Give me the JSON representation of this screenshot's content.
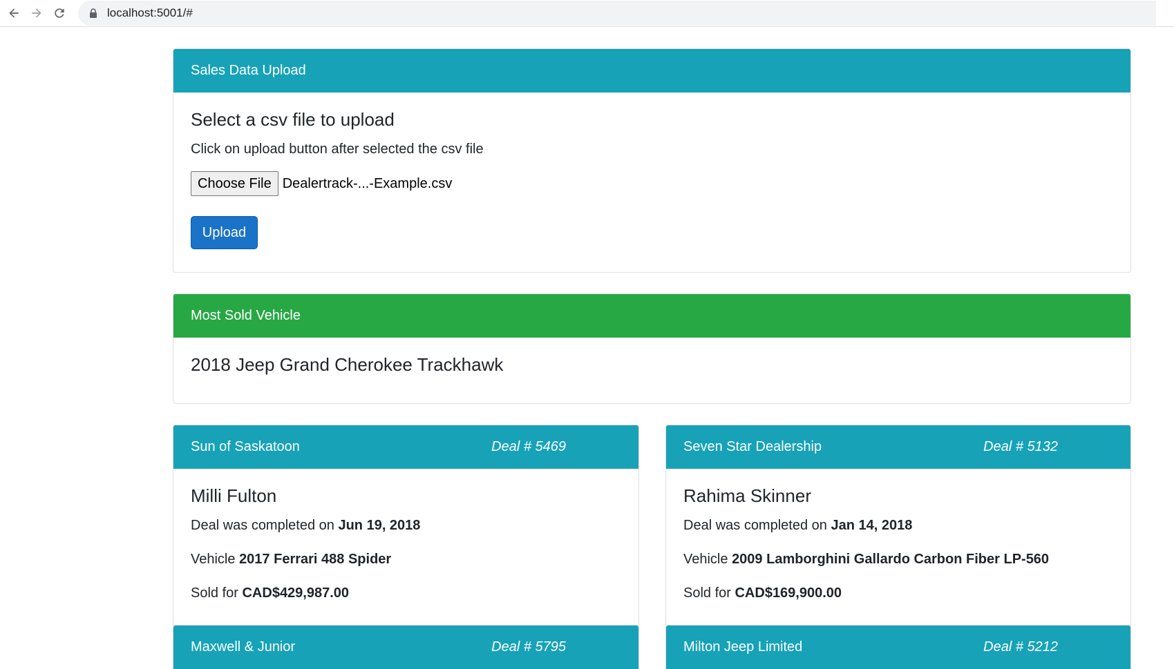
{
  "browser": {
    "url": "localhost:5001/#"
  },
  "upload": {
    "header": "Sales Data Upload",
    "title": "Select a csv file to upload",
    "instruction": "Click on upload button after selected the csv file",
    "choose_label": "Choose File",
    "file_name": "Dealertrack-...-Example.csv",
    "upload_label": "Upload"
  },
  "most_sold": {
    "header": "Most Sold Vehicle",
    "vehicle": "2018 Jeep Grand Cherokee Trackhawk"
  },
  "deals": [
    {
      "dealer": "Sun of Saskatoon",
      "deal_no": "Deal # 5469",
      "customer": "Milli Fulton",
      "date_prefix": "Deal was completed on ",
      "date": "Jun 19, 2018",
      "vehicle_prefix": "Vehicle ",
      "vehicle": "2017 Ferrari 488 Spider",
      "price_prefix": "Sold for ",
      "price": "CAD$429,987.00"
    },
    {
      "dealer": "Seven Star Dealership",
      "deal_no": "Deal # 5132",
      "customer": "Rahima Skinner",
      "date_prefix": "Deal was completed on ",
      "date": "Jan 14, 2018",
      "vehicle_prefix": "Vehicle ",
      "vehicle": "2009 Lamborghini Gallardo Carbon Fiber LP-560",
      "price_prefix": "Sold for ",
      "price": "CAD$169,900.00"
    },
    {
      "dealer": "Maxwell & Junior",
      "deal_no": "Deal # 5795"
    },
    {
      "dealer": "Milton Jeep Limited",
      "deal_no": "Deal # 5212"
    }
  ]
}
